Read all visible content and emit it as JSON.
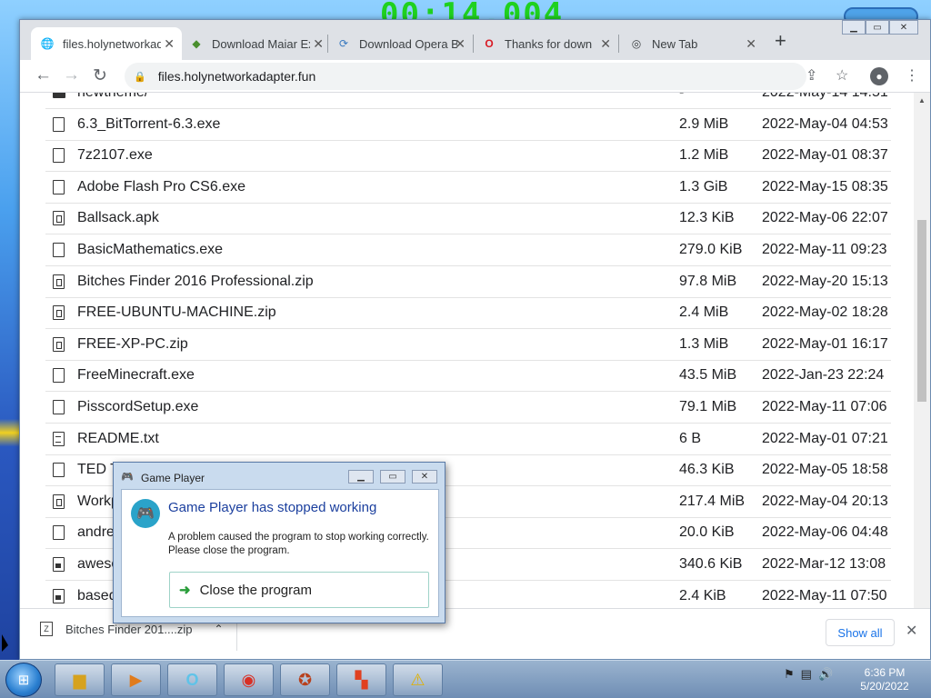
{
  "desktop": {
    "timer_text": "00:14.004"
  },
  "browser": {
    "tabs": [
      {
        "title": "files.holynetworkadapter.fun",
        "icon": "globe-icon",
        "active": true
      },
      {
        "title": "Download Maiar Exchange",
        "icon": "maiar-icon"
      },
      {
        "title": "Download Opera Browser",
        "icon": "opera-gx-icon"
      },
      {
        "title": "Thanks for downloading Opera",
        "icon": "opera-icon"
      },
      {
        "title": "New Tab",
        "icon": "chrome-icon"
      }
    ],
    "newtab_label": "+",
    "address": "files.holynetworkadapter.fun",
    "files": [
      {
        "name": "newtheme/",
        "size": "-",
        "date": "2022-May-14 14:51",
        "type": "folder"
      },
      {
        "name": "6.3_BitTorrent-6.3.exe",
        "size": "2.9 MiB",
        "date": "2022-May-04 04:53",
        "type": "file"
      },
      {
        "name": "7z2107.exe",
        "size": "1.2 MiB",
        "date": "2022-May-01 08:37",
        "type": "file"
      },
      {
        "name": "Adobe Flash Pro CS6.exe",
        "size": "1.3 GiB",
        "date": "2022-May-15 08:35",
        "type": "file"
      },
      {
        "name": "Ballsack.apk",
        "size": "12.3 KiB",
        "date": "2022-May-06 22:07",
        "type": "zip"
      },
      {
        "name": "BasicMathematics.exe",
        "size": "279.0 KiB",
        "date": "2022-May-11 09:23",
        "type": "file"
      },
      {
        "name": "Bitches Finder 2016 Professional.zip",
        "size": "97.8 MiB",
        "date": "2022-May-20 15:13",
        "type": "zip"
      },
      {
        "name": "FREE-UBUNTU-MACHINE.zip",
        "size": "2.4 MiB",
        "date": "2022-May-02 18:28",
        "type": "zip"
      },
      {
        "name": "FREE-XP-PC.zip",
        "size": "1.3 MiB",
        "date": "2022-May-01 16:17",
        "type": "zip"
      },
      {
        "name": "FreeMinecraft.exe",
        "size": "43.5 MiB",
        "date": "2022-Jan-23 22:24",
        "type": "file"
      },
      {
        "name": "PisscordSetup.exe",
        "size": "79.1 MiB",
        "date": "2022-May-11 07:06",
        "type": "file"
      },
      {
        "name": "README.txt",
        "size": "6 B",
        "date": "2022-May-01 07:21",
        "type": "txt"
      },
      {
        "name": "TED Ta",
        "size": "46.3 KiB",
        "date": "2022-May-05 18:58",
        "type": "file"
      },
      {
        "name": "Workp",
        "size": "217.4 MiB",
        "date": "2022-May-04 20:13",
        "type": "zip"
      },
      {
        "name": "andre",
        "size": "20.0 KiB",
        "date": "2022-May-06 04:48",
        "type": "file"
      },
      {
        "name": "aweso",
        "size": "340.6 KiB",
        "date": "2022-Mar-12 13:08",
        "type": "img"
      },
      {
        "name": "based",
        "size": "2.4 KiB",
        "date": "2022-May-11 07:50",
        "type": "img"
      }
    ],
    "download": {
      "filename": "Bitches Finder 201....zip",
      "show_all_label": "Show all"
    }
  },
  "dialog": {
    "title": "Game Player",
    "heading": "Game Player has stopped working",
    "message": "A problem caused the program to stop working correctly. Please close the program.",
    "close_label": "Close the program"
  },
  "taskbar": {
    "time": "6:36 PM",
    "date": "5/20/2022"
  }
}
